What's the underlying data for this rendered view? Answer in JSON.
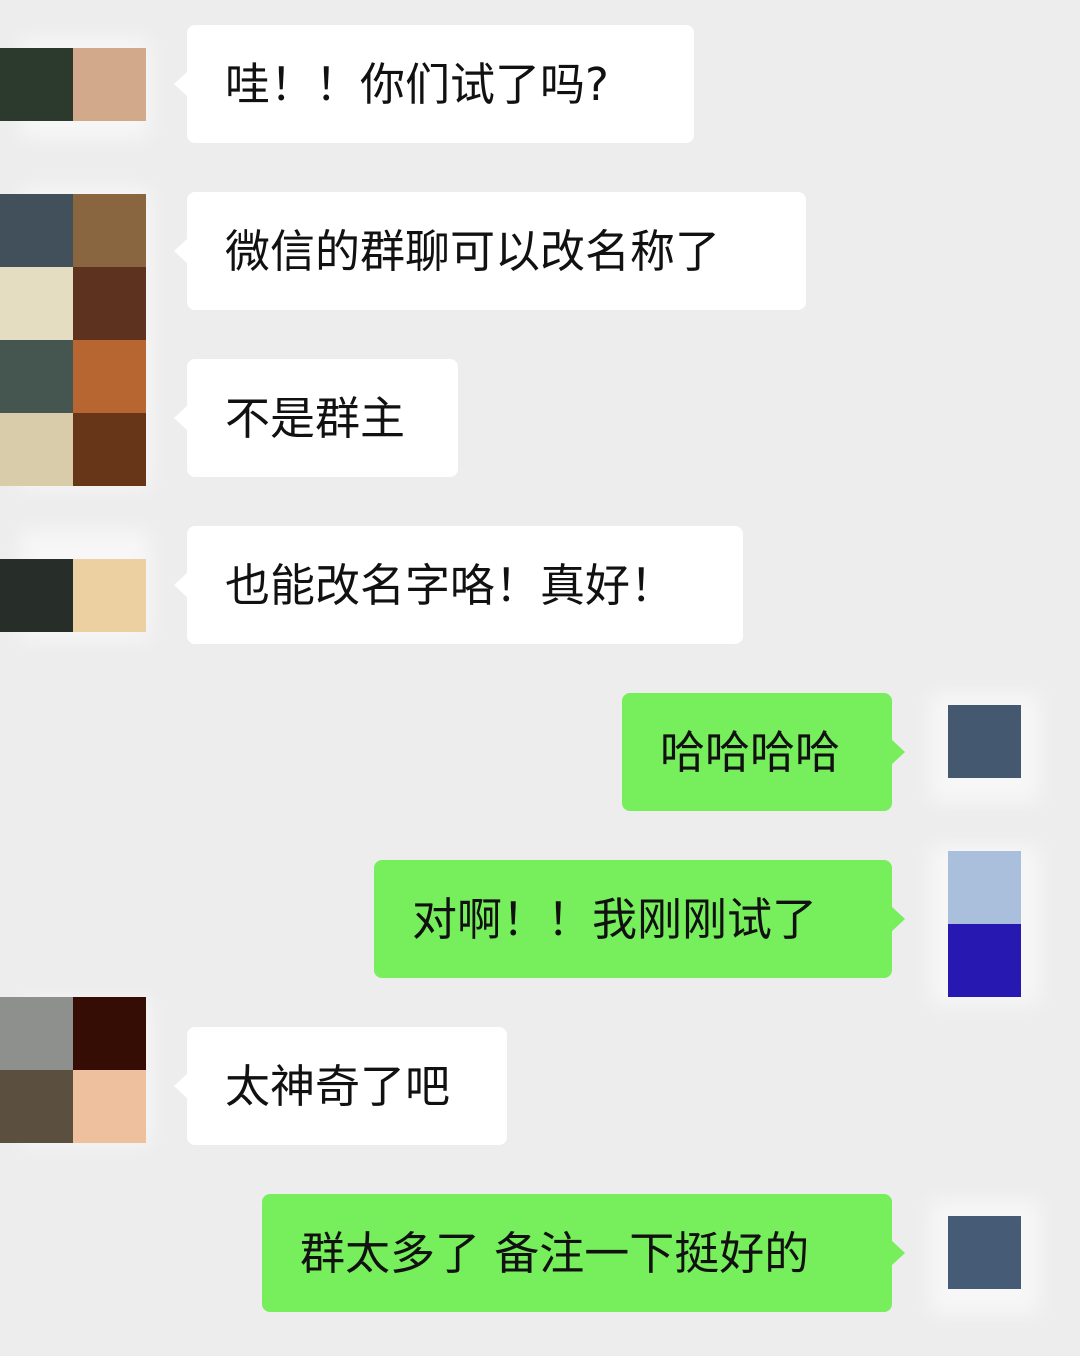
{
  "messages": [
    {
      "side": "left",
      "text": "哇！！你们试了吗?"
    },
    {
      "side": "left",
      "text": "微信的群聊可以改名称了"
    },
    {
      "side": "left",
      "text": "不是群主"
    },
    {
      "side": "left",
      "text": "也能改名字咯！真好！"
    },
    {
      "side": "right",
      "text": "哈哈哈哈"
    },
    {
      "side": "right",
      "text": "对啊！！我刚刚试了"
    },
    {
      "side": "left",
      "text": "太神奇了吧"
    },
    {
      "side": "right",
      "text": "群太多了 备注一下挺好的"
    }
  ],
  "avatar_colors": {
    "a1": [
      "#2c3a2e",
      "#d2a98a"
    ],
    "a2": [
      "#42505c",
      "#8a6640",
      "#e5ddc1",
      "#5d321e",
      "#44564f",
      "#b86631",
      "#d8ccaa",
      "#673619"
    ],
    "a3": [
      "#272e29",
      "#edd0a2"
    ],
    "a4": [
      "#44586f"
    ],
    "a5": [
      "#a9bfdc",
      "#2718b2"
    ],
    "a6": [
      "#8d908c",
      "#360d04",
      "#5b5040",
      "#eec09e"
    ],
    "a7": [
      "#465b76"
    ]
  },
  "colors": {
    "background": "#ededed",
    "left_bubble": "#ffffff",
    "right_bubble": "#77ee5c",
    "text": "#111111"
  }
}
